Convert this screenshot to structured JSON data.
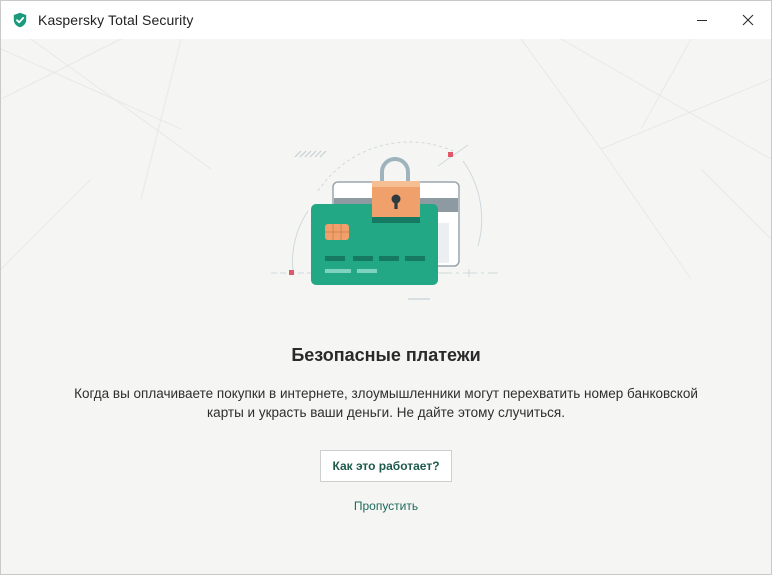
{
  "window": {
    "title": "Kaspersky Total Security",
    "logo_icon": "kaspersky-shield-icon",
    "controls": [
      "minimize-icon",
      "close-icon"
    ]
  },
  "main": {
    "heading": "Безопасные платежи",
    "description_line1": "Когда вы оплачиваете покупки в интернете, злоумышленники могут перехватить номер банковской",
    "description_line2": "карты и украсть ваши деньги. Не дайте этому случиться.",
    "how_it_works_label": "Как это работает?",
    "skip_label": "Пропустить"
  },
  "illustration": {
    "icon": "secure-payment-card-padlock-illustration"
  },
  "colors": {
    "brand_green": "#1c9a7e",
    "card_green": "#23a886",
    "lock_orange": "#f0a06a",
    "link_green": "#1d6b5a",
    "marker_red": "#e0586a"
  }
}
